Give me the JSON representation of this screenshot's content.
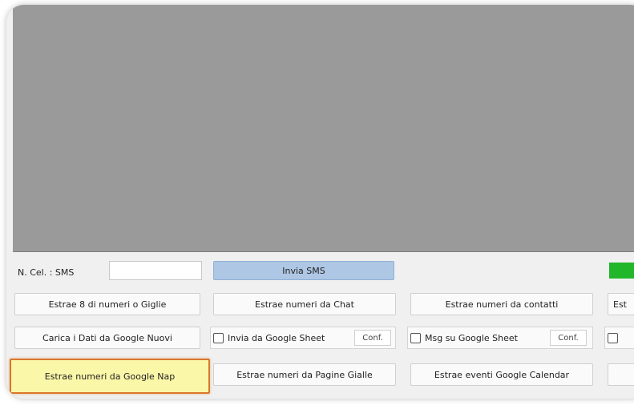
{
  "phone_label": "N. Cel. : SMS",
  "phone_input_value": "",
  "buttons": {
    "send_sms": "Invia SMS",
    "row1_col1": "Estrae 8 di numeri o Giglie",
    "row1_col2": "Estrae numeri da Chat",
    "row1_col3": "Estrae numeri da contatti",
    "row1_col4": "Est",
    "row2_col1": "Carica i Dati da Google Nuovi",
    "row4_col1": "Estrae numeri da Google Nap",
    "row4_col2": "Estrae numeri da Pagine Gialle",
    "row4_col3": "Estrae eventi Google Calendar"
  },
  "checks": {
    "invia_google_sheet": "Invia da Google Sheet",
    "msg_google_sheet": "Msg su Google Sheet"
  },
  "conf_label": "Conf."
}
